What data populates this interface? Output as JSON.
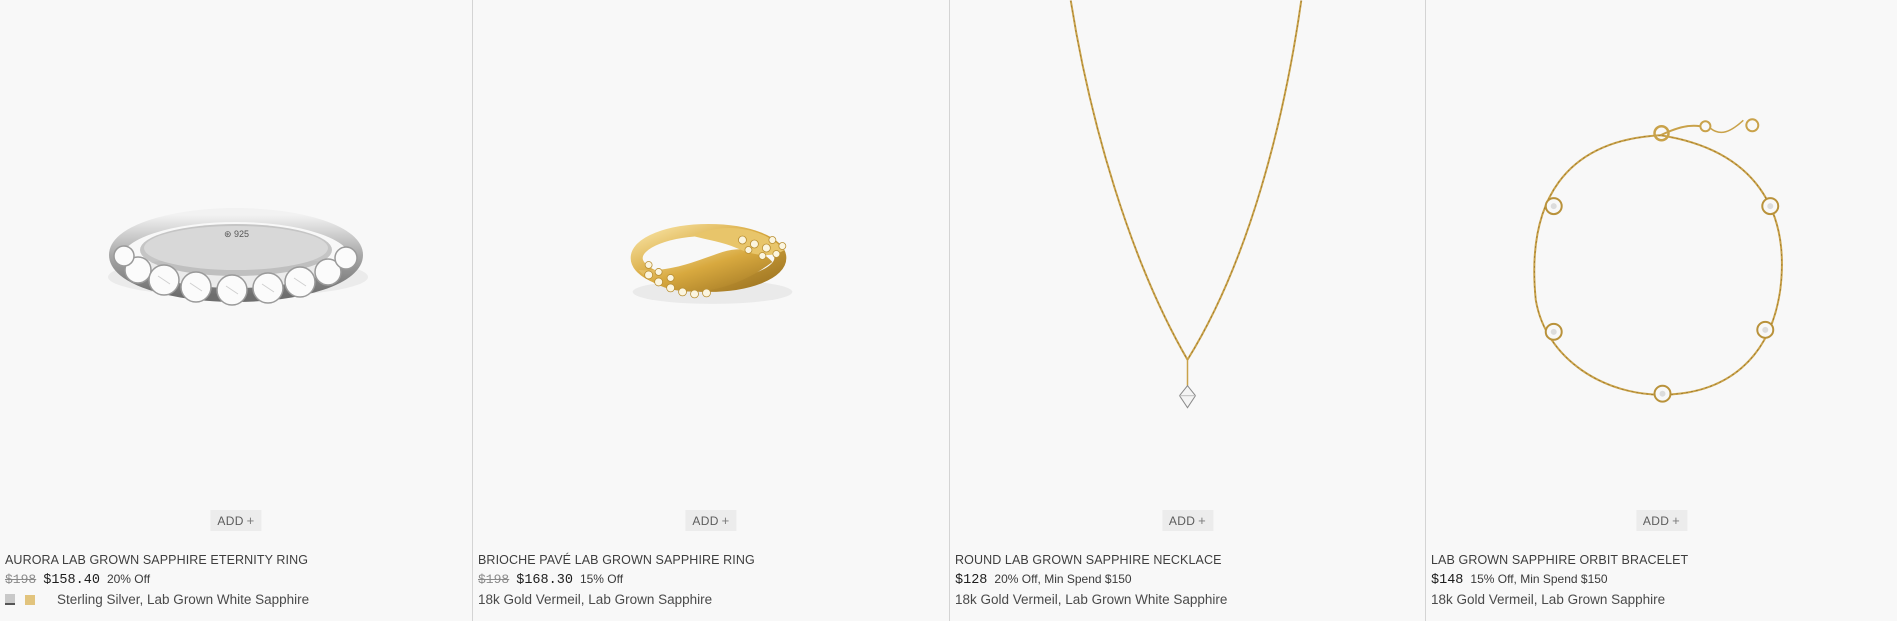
{
  "add_label": "ADD",
  "add_plus": "+",
  "products": [
    {
      "name": "AURORA LAB GROWN SAPPHIRE ETERNITY RING",
      "price_original": "$198",
      "price_current": "$158.40",
      "discount": "20% Off",
      "material": "Sterling Silver, Lab Grown White Sapphire",
      "swatches": [
        "silver",
        "gold"
      ],
      "image": "ring-icon"
    },
    {
      "name": "BRIOCHE PAVÉ LAB GROWN SAPPHIRE RING",
      "price_original": "$198",
      "price_current": "$168.30",
      "discount": "15% Off",
      "material": "18k Gold Vermeil, Lab Grown Sapphire",
      "image": "ring-icon"
    },
    {
      "name": "ROUND LAB GROWN SAPPHIRE NECKLACE",
      "price_current": "$128",
      "discount": "20% Off, Min Spend $150",
      "material": "18k Gold Vermeil, Lab Grown White Sapphire",
      "image": "necklace-icon"
    },
    {
      "name": "LAB GROWN SAPPHIRE ORBIT BRACELET",
      "price_current": "$148",
      "discount": "15% Off, Min Spend $150",
      "material": "18k Gold Vermeil, Lab Grown Sapphire",
      "image": "bracelet-icon"
    }
  ],
  "colors": {
    "silver": "#c9c9c9",
    "gold": "#e2c47d",
    "background": "#f7f7f7"
  }
}
